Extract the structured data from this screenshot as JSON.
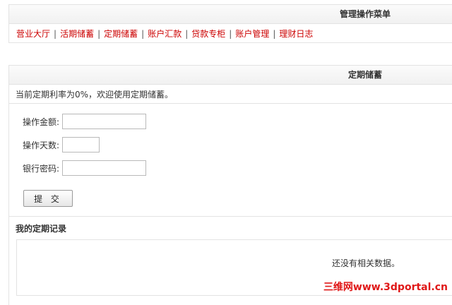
{
  "menu_panel": {
    "title": "管理操作菜单",
    "separator": "|",
    "nav_items": [
      "营业大厅",
      "活期储蓄",
      "定期储蓄",
      "账户汇款",
      "贷款专柜",
      "账户管理",
      "理财日志"
    ]
  },
  "deposit_panel": {
    "title": "定期储蓄",
    "notice": "当前定期利率为0%，欢迎使用定期储蓄。",
    "form": {
      "amount_label": "操作金额:",
      "amount_value": "",
      "days_label": "操作天数:",
      "days_value": "",
      "password_label": "银行密码:",
      "password_value": "",
      "submit_label": "提 交"
    },
    "records": {
      "title": "我的定期记录",
      "empty_message": "还没有相关数据。"
    }
  },
  "watermark": "三维网www.3dportal.cn",
  "colors": {
    "nav_link": "#cc0000",
    "header_bg": "#f1f1f1",
    "border": "#e3e3e3",
    "watermark": "#e01818"
  }
}
